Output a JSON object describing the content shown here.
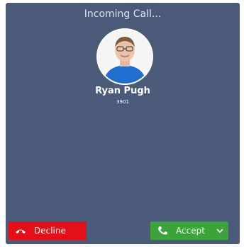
{
  "call": {
    "header": "Incoming Call...",
    "caller_name": "Ryan Pugh",
    "extension": "3901"
  },
  "actions": {
    "decline_label": "Decline",
    "accept_label": "Accept"
  },
  "icons": {
    "decline": "phone-hangup-icon",
    "accept": "phone-icon",
    "accept_menu": "chevron-down-icon"
  },
  "colors": {
    "panel": "#4a5a78",
    "decline": "#e3101a",
    "accept": "#3aa33a"
  }
}
